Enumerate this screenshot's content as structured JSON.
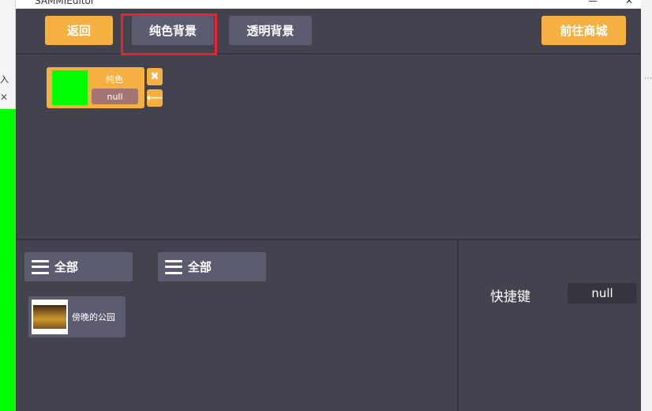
{
  "window": {
    "title": "SAMMIEditor",
    "controls": {
      "minimize": "—",
      "maximize": "☐",
      "close": "✕"
    }
  },
  "background": {
    "left_text": "入",
    "left_close": "✕",
    "right_mark": "⋯"
  },
  "toolbar": {
    "back_label": "返回",
    "solid_bg_label": "纯色背景",
    "transparent_bg_label": "透明背景",
    "store_label": "前往商城"
  },
  "layer": {
    "name": "纯色",
    "value": "null",
    "swatch_color": "#00ff00",
    "remove_icon": "✖",
    "move_icon": "⟵"
  },
  "filters": [
    {
      "label": "全部"
    },
    {
      "label": "全部"
    }
  ],
  "assets": [
    {
      "label": "傍晚的公园"
    }
  ],
  "shortcut": {
    "label": "快捷键",
    "value": "null"
  },
  "colors": {
    "accent": "#f6b042",
    "panel": "#42434f",
    "button_dark": "#5b5c70",
    "highlight": "#ee2226"
  }
}
